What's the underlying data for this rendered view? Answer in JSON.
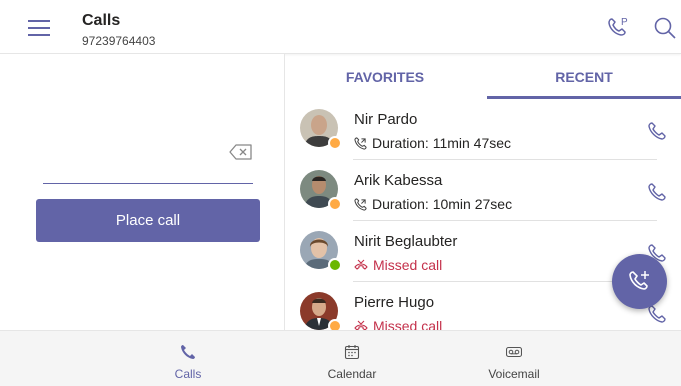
{
  "header": {
    "title": "Calls",
    "subtitle": "97239764403"
  },
  "dialer": {
    "button_label": "Place call"
  },
  "tabs": [
    {
      "label": "FAVORITES",
      "selected": false
    },
    {
      "label": "RECENT",
      "selected": true
    }
  ],
  "recent_calls": [
    {
      "name": "Nir Pardo",
      "detail": "Duration: 11min 47sec",
      "type": "outgoing",
      "presence": "away"
    },
    {
      "name": "Arik Kabessa",
      "detail": "Duration: 10min 27sec",
      "type": "outgoing",
      "presence": "away"
    },
    {
      "name": "Nirit Beglaubter",
      "detail": "Missed call",
      "type": "missed",
      "presence": "available"
    },
    {
      "name": "Pierre Hugo",
      "detail": "Missed call",
      "type": "missed",
      "presence": "away"
    }
  ],
  "bottom_nav": [
    {
      "label": "Calls",
      "icon": "phone-icon",
      "active": true
    },
    {
      "label": "Calendar",
      "icon": "calendar-icon",
      "active": false
    },
    {
      "label": "Voicemail",
      "icon": "voicemail-icon",
      "active": false
    }
  ],
  "colors": {
    "accent": "#6264a7",
    "missed": "#c4314b",
    "away": "#ffaa44",
    "available": "#6bb700"
  }
}
